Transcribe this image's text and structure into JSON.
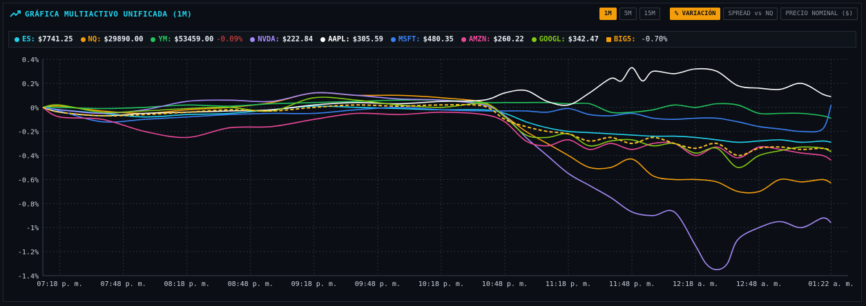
{
  "header": {
    "title": "GRÁFICA MULTIACTIVO UNIFICADA (1M)",
    "buttons": [
      "1M",
      "5M",
      "15M",
      "% VARIACIÓN",
      "SPREAD vs NQ",
      "PRECIO NOMINAL ($)"
    ],
    "active_timeframe": "1M",
    "active_mode": "% VARIACIÓN"
  },
  "legend": [
    {
      "symbol": "ES:",
      "value": "$7741.25",
      "change": "",
      "color": "#22d3ee",
      "marker": "dot"
    },
    {
      "symbol": "NQ:",
      "value": "$29890.00",
      "change": "",
      "color": "#f59e0b",
      "marker": "dot"
    },
    {
      "symbol": "YM:",
      "value": "$53459.00",
      "change": "-0.09%",
      "color": "#22c55e",
      "marker": "dot"
    },
    {
      "symbol": "NVDA:",
      "value": "$222.84",
      "change": "",
      "color": "#a78bfa",
      "marker": "dot"
    },
    {
      "symbol": "AAPL:",
      "value": "$305.59",
      "change": "",
      "color": "#ffffff",
      "marker": "dot"
    },
    {
      "symbol": "MSFT:",
      "value": "$480.35",
      "change": "",
      "color": "#3b82f6",
      "marker": "dot"
    },
    {
      "symbol": "AMZN:",
      "value": "$260.22",
      "change": "",
      "color": "#ec4899",
      "marker": "dot"
    },
    {
      "symbol": "GOOGL:",
      "value": "$342.47",
      "change": "",
      "color": "#84cc16",
      "marker": "dot"
    },
    {
      "symbol": "BIG5:",
      "value": "",
      "change": "-0.70%",
      "color": "#f59e0b",
      "marker": "square"
    }
  ],
  "chart_data": {
    "type": "line",
    "ylim": [
      -1.4,
      0.4
    ],
    "yticks": [
      0.4,
      0.2,
      0,
      -0.2,
      -0.4,
      -0.6,
      -0.8,
      -1,
      -1.2,
      -1.4
    ],
    "ytick_labels": [
      "0.4%",
      "0.2%",
      "0%",
      "-0.2%",
      "-0.4%",
      "-0.6%",
      "-0.8%",
      "-1%",
      "-1.2%",
      "-1.4%"
    ],
    "x_labels": [
      "07:18 p. m.",
      "07:48 p. m.",
      "08:18 p. m.",
      "08:48 p. m.",
      "09:18 p. m.",
      "09:48 p. m.",
      "10:18 p. m.",
      "10:48 p. m.",
      "11:18 p. m.",
      "11:48 p. m.",
      "12:18 a. m.",
      "12:48 a. m.",
      "01:22 a. m."
    ],
    "x_minutes": [
      0,
      30,
      60,
      90,
      120,
      150,
      180,
      210,
      240,
      270,
      300,
      330,
      364
    ],
    "x_range": [
      -8,
      372
    ],
    "grid": true,
    "series": [
      {
        "name": "ES",
        "color": "#22d3ee",
        "x": [
          -8,
          0,
          20,
          40,
          60,
          80,
          100,
          120,
          140,
          160,
          180,
          200,
          210,
          220,
          230,
          240,
          250,
          260,
          270,
          280,
          290,
          300,
          310,
          320,
          330,
          340,
          350,
          360,
          364
        ],
        "y": [
          0,
          -0.02,
          -0.05,
          -0.08,
          -0.06,
          -0.05,
          -0.02,
          0.01,
          0,
          -0.01,
          -0.02,
          -0.02,
          -0.05,
          -0.12,
          -0.17,
          -0.2,
          -0.21,
          -0.22,
          -0.23,
          -0.24,
          -0.24,
          -0.25,
          -0.27,
          -0.29,
          -0.28,
          -0.27,
          -0.29,
          -0.28,
          -0.29
        ]
      },
      {
        "name": "NQ",
        "color": "#f59e0b",
        "x": [
          -8,
          0,
          20,
          40,
          60,
          80,
          100,
          120,
          140,
          160,
          180,
          200,
          210,
          220,
          230,
          240,
          250,
          260,
          270,
          280,
          290,
          300,
          310,
          320,
          330,
          340,
          350,
          360,
          364
        ],
        "y": [
          0,
          0.01,
          -0.03,
          -0.05,
          -0.02,
          0,
          0.04,
          0.12,
          0.1,
          0.1,
          0.08,
          0.04,
          -0.07,
          -0.2,
          -0.3,
          -0.4,
          -0.5,
          -0.5,
          -0.43,
          -0.57,
          -0.6,
          -0.6,
          -0.62,
          -0.7,
          -0.7,
          -0.6,
          -0.62,
          -0.6,
          -0.63
        ]
      },
      {
        "name": "YM",
        "color": "#22c55e",
        "x": [
          -8,
          0,
          20,
          40,
          60,
          80,
          100,
          120,
          140,
          160,
          180,
          200,
          210,
          220,
          230,
          240,
          250,
          260,
          270,
          280,
          290,
          300,
          310,
          320,
          330,
          340,
          350,
          360,
          364
        ],
        "y": [
          0,
          0,
          -0.01,
          0,
          0.02,
          0.01,
          0.03,
          0.04,
          0.05,
          0.06,
          0.06,
          0.04,
          0.04,
          0.04,
          0.04,
          0.03,
          0.03,
          -0.04,
          -0.04,
          -0.02,
          0.02,
          0,
          0.03,
          0.02,
          -0.05,
          -0.05,
          -0.05,
          -0.07,
          -0.09
        ]
      },
      {
        "name": "NVDA",
        "color": "#a78bfa",
        "x": [
          -8,
          0,
          20,
          40,
          60,
          80,
          100,
          120,
          140,
          160,
          180,
          200,
          210,
          220,
          230,
          240,
          250,
          260,
          270,
          280,
          290,
          300,
          305,
          310,
          315,
          320,
          330,
          340,
          350,
          360,
          364
        ],
        "y": [
          0,
          -0.02,
          -0.05,
          -0.02,
          0.05,
          0.06,
          0.05,
          0.12,
          0.1,
          0.07,
          0.06,
          0.02,
          -0.07,
          -0.25,
          -0.4,
          -0.55,
          -0.65,
          -0.75,
          -0.87,
          -0.9,
          -0.87,
          -1.15,
          -1.3,
          -1.35,
          -1.3,
          -1.1,
          -1.0,
          -0.95,
          -1.0,
          -0.92,
          -0.96
        ]
      },
      {
        "name": "AAPL",
        "color": "#ffffff",
        "x": [
          -8,
          0,
          20,
          40,
          60,
          80,
          100,
          120,
          140,
          160,
          180,
          200,
          210,
          220,
          230,
          240,
          250,
          260,
          265,
          270,
          275,
          280,
          290,
          300,
          310,
          320,
          330,
          340,
          350,
          360,
          364
        ],
        "y": [
          0,
          -0.04,
          -0.07,
          -0.05,
          -0.04,
          -0.03,
          -0.02,
          0.02,
          0.04,
          0.03,
          0.05,
          0.06,
          0.12,
          0.14,
          0.05,
          0.02,
          0.12,
          0.24,
          0.22,
          0.33,
          0.22,
          0.3,
          0.28,
          0.32,
          0.3,
          0.18,
          0.16,
          0.15,
          0.2,
          0.11,
          0.09
        ]
      },
      {
        "name": "MSFT",
        "color": "#3b82f6",
        "x": [
          -8,
          0,
          20,
          40,
          60,
          80,
          100,
          120,
          140,
          160,
          180,
          200,
          210,
          220,
          230,
          240,
          250,
          260,
          270,
          280,
          290,
          300,
          310,
          320,
          330,
          340,
          350,
          360,
          364
        ],
        "y": [
          0,
          -0.03,
          -0.12,
          -0.1,
          -0.08,
          -0.06,
          -0.05,
          -0.05,
          -0.02,
          0,
          -0.02,
          -0.03,
          -0.03,
          -0.03,
          -0.04,
          -0.01,
          -0.06,
          -0.07,
          -0.05,
          -0.09,
          -0.1,
          -0.09,
          -0.09,
          -0.12,
          -0.16,
          -0.18,
          -0.2,
          -0.18,
          0.02
        ]
      },
      {
        "name": "AMZN",
        "color": "#ec4899",
        "x": [
          -8,
          0,
          20,
          40,
          60,
          80,
          100,
          120,
          140,
          160,
          180,
          200,
          210,
          220,
          230,
          240,
          250,
          260,
          270,
          280,
          290,
          300,
          310,
          320,
          330,
          340,
          350,
          360,
          364
        ],
        "y": [
          0,
          -0.08,
          -0.1,
          -0.2,
          -0.25,
          -0.17,
          -0.16,
          -0.1,
          -0.05,
          -0.06,
          -0.04,
          -0.06,
          -0.12,
          -0.28,
          -0.32,
          -0.27,
          -0.35,
          -0.3,
          -0.35,
          -0.3,
          -0.3,
          -0.4,
          -0.33,
          -0.42,
          -0.33,
          -0.35,
          -0.38,
          -0.4,
          -0.44
        ]
      },
      {
        "name": "GOOGL",
        "color": "#84cc16",
        "x": [
          -8,
          0,
          20,
          40,
          60,
          80,
          100,
          120,
          140,
          160,
          180,
          200,
          210,
          220,
          230,
          240,
          250,
          260,
          270,
          280,
          290,
          300,
          310,
          320,
          330,
          340,
          350,
          360,
          364
        ],
        "y": [
          0,
          0.02,
          -0.04,
          -0.03,
          -0.01,
          0,
          -0.03,
          0.08,
          0.06,
          0.02,
          0,
          0.03,
          -0.08,
          -0.23,
          -0.25,
          -0.22,
          -0.32,
          -0.28,
          -0.27,
          -0.32,
          -0.3,
          -0.38,
          -0.34,
          -0.5,
          -0.4,
          -0.36,
          -0.33,
          -0.34,
          -0.37
        ]
      },
      {
        "name": "BIG5",
        "color": "#fbbf24",
        "dashed": true,
        "x": [
          -8,
          0,
          20,
          40,
          60,
          80,
          100,
          120,
          140,
          160,
          180,
          200,
          210,
          220,
          230,
          240,
          250,
          260,
          270,
          280,
          290,
          300,
          310,
          320,
          330,
          340,
          350,
          360,
          364
        ],
        "y": [
          0,
          -0.04,
          -0.07,
          -0.06,
          -0.04,
          -0.02,
          -0.03,
          0.0,
          0.02,
          0.01,
          0.02,
          0.01,
          -0.1,
          -0.16,
          -0.2,
          -0.22,
          -0.28,
          -0.25,
          -0.3,
          -0.25,
          -0.3,
          -0.34,
          -0.3,
          -0.4,
          -0.34,
          -0.33,
          -0.35,
          -0.34,
          -0.36
        ]
      }
    ]
  }
}
